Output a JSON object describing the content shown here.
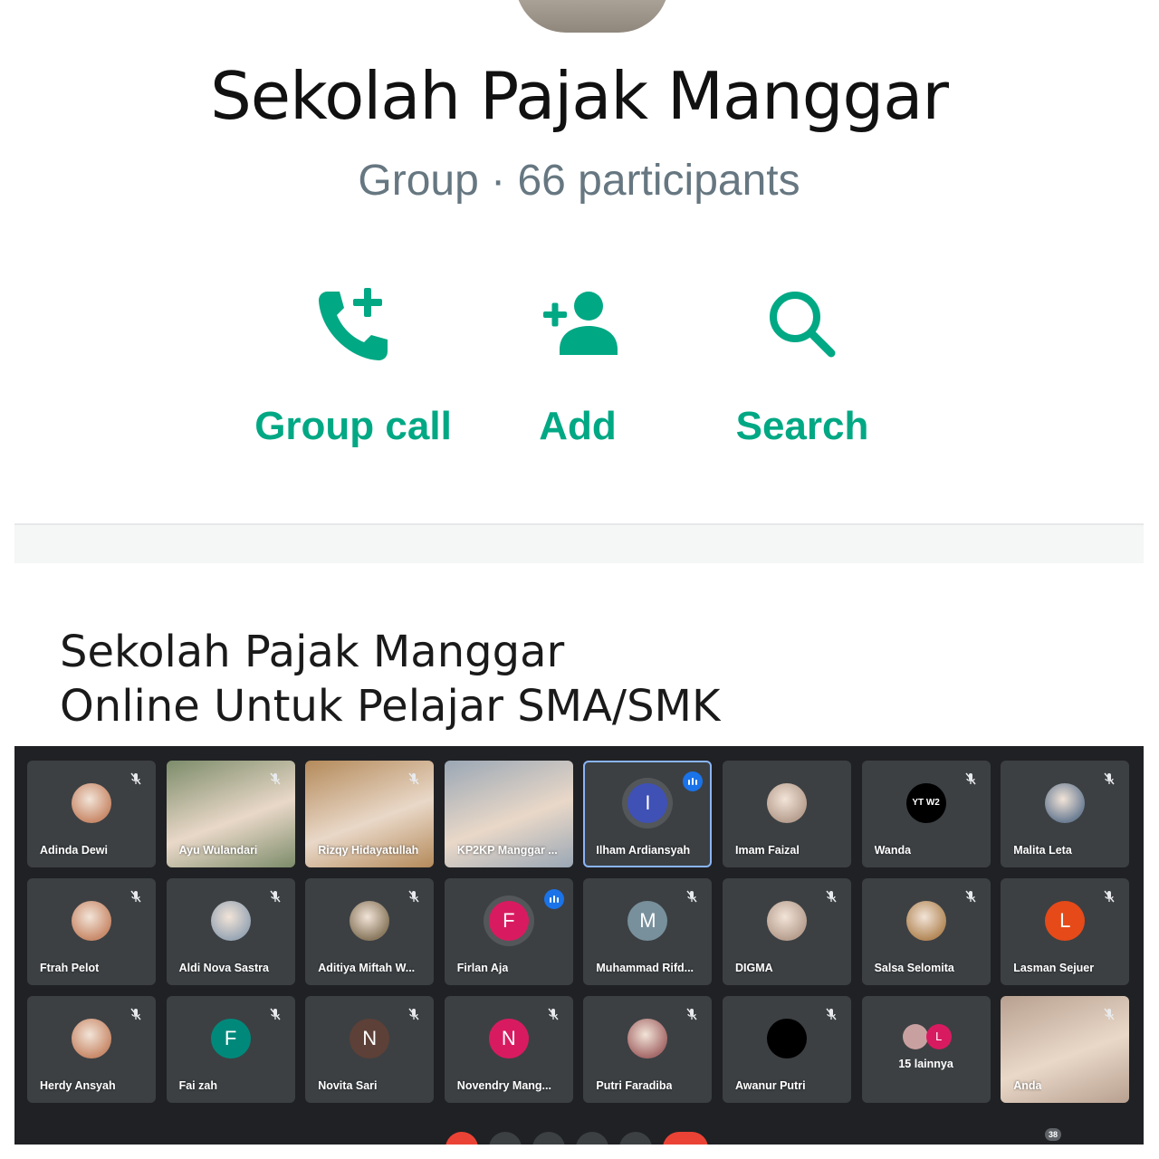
{
  "group": {
    "name": "Sekolah Pajak Manggar",
    "subtitle": "Group · 66 participants",
    "actions": [
      {
        "label": "Group call",
        "icon": "add-call-icon"
      },
      {
        "label": "Add",
        "icon": "add-person-icon"
      },
      {
        "label": "Search",
        "icon": "search-icon"
      }
    ],
    "accent_color": "#00a884"
  },
  "caption": {
    "line1": "Sekolah Pajak Manggar",
    "line2": "Online Untuk Pelajar SMA/SMK"
  },
  "meet": {
    "participants": [
      {
        "name": "Adinda Dewi",
        "avatar": "photo-icon",
        "muted": true
      },
      {
        "name": "Ayu Wulandari",
        "avatar": "video",
        "muted": true
      },
      {
        "name": "Rizqy Hidayatullah",
        "avatar": "video",
        "muted": true
      },
      {
        "name": "KP2KP Manggar ...",
        "avatar": "video",
        "muted": false
      },
      {
        "name": "Ilham Ardiansyah",
        "avatar": "letter",
        "letter": "I",
        "color": "#3f51b5",
        "speaking": true
      },
      {
        "name": "Imam Faizal",
        "avatar": "photo-icon",
        "muted": false
      },
      {
        "name": "Wanda",
        "avatar": "logo",
        "logo_text": "YT W2",
        "muted": true
      },
      {
        "name": "Malita Leta",
        "avatar": "photo-icon",
        "muted": true
      },
      {
        "name": "Ftrah Pelot",
        "avatar": "photo-icon",
        "muted": true
      },
      {
        "name": "Aldi Nova Sastra",
        "avatar": "photo-icon",
        "muted": true
      },
      {
        "name": "Aditiya Miftah W...",
        "avatar": "photo-icon",
        "muted": true
      },
      {
        "name": "Firlan Aja",
        "avatar": "letter",
        "letter": "F",
        "color": "#d81b60",
        "speaking": true
      },
      {
        "name": "Muhammad Rifd...",
        "avatar": "letter",
        "letter": "M",
        "color": "#78909c",
        "muted": true
      },
      {
        "name": "DIGMA",
        "avatar": "photo-icon",
        "muted": true
      },
      {
        "name": "Salsa Selomita",
        "avatar": "photo-icon",
        "muted": true
      },
      {
        "name": "Lasman Sejuer",
        "avatar": "letter",
        "letter": "L",
        "color": "#e64a19",
        "muted": true
      },
      {
        "name": "Herdy Ansyah",
        "avatar": "photo-icon",
        "muted": true
      },
      {
        "name": "Fai zah",
        "avatar": "letter",
        "letter": "F",
        "color": "#00897b",
        "muted": true
      },
      {
        "name": "Novita Sari",
        "avatar": "letter",
        "letter": "N",
        "color": "#5d4037",
        "muted": true
      },
      {
        "name": "Novendry Mang...",
        "avatar": "letter",
        "letter": "N",
        "color": "#d81b60",
        "muted": true
      },
      {
        "name": "Putri Faradiba",
        "avatar": "photo-icon",
        "muted": true
      },
      {
        "name": "Awanur Putri",
        "avatar": "photo-icon",
        "muted": true
      },
      {
        "name": "15 lainnya",
        "avatar": "more",
        "letter": "L",
        "color": "#d81b60"
      },
      {
        "name": "Anda",
        "avatar": "video",
        "muted": true
      }
    ],
    "participant_badge": "38"
  }
}
